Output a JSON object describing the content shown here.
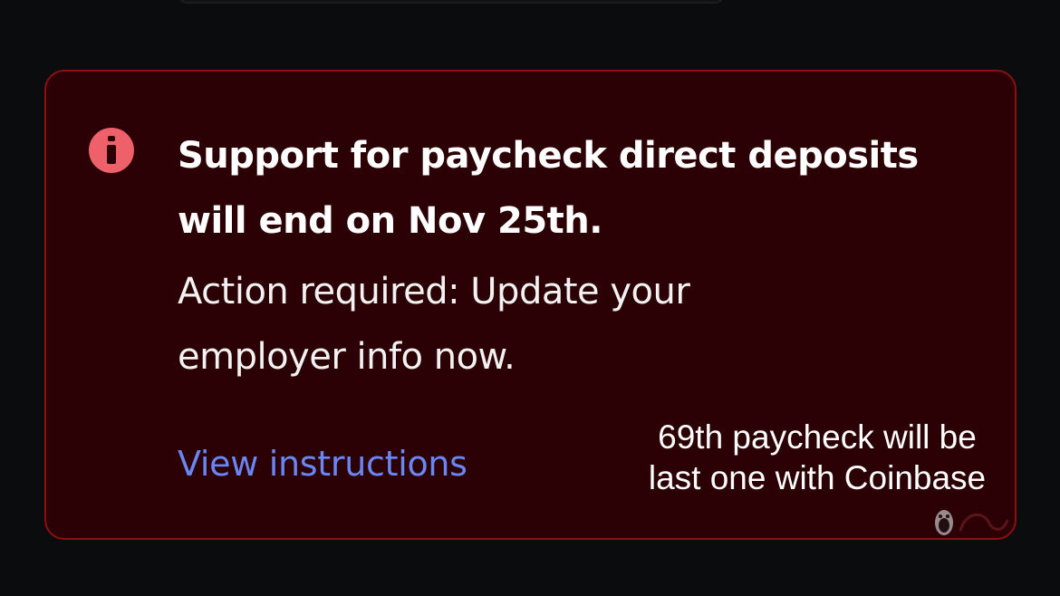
{
  "alert": {
    "icon": "info-icon",
    "title": "Support for paycheck direct deposits will end on Nov 25th.",
    "body": "Action required: Update your employer info now.",
    "link_label": "View instructions",
    "colors": {
      "background": "#2c0105",
      "border": "#8e0e14",
      "icon": "#ee616b",
      "link": "#6a86f5"
    }
  },
  "overlay_caption": {
    "line1": "69th paycheck will be",
    "line2": "last one with Coinbase"
  },
  "watermark": {
    "icon": "cartoon-watermark-icon"
  }
}
